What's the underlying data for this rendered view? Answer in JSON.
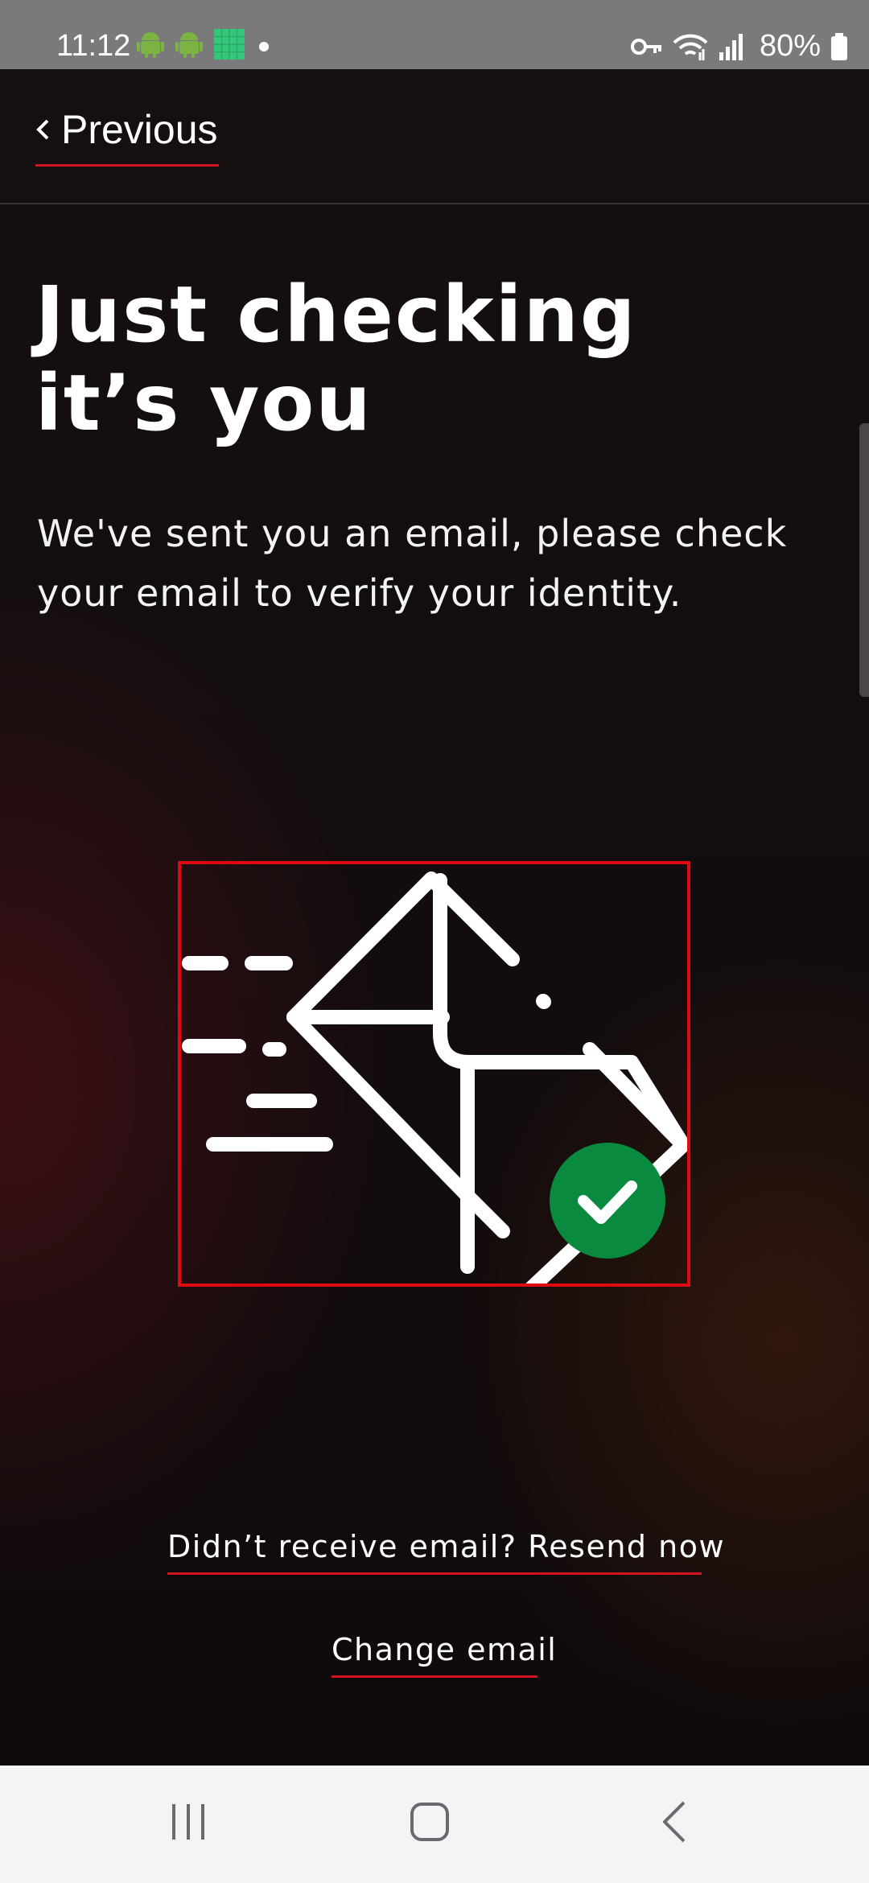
{
  "status_bar": {
    "time": "11:12",
    "battery": "80%",
    "icons": [
      "android-icon",
      "android-icon",
      "grid-app-icon",
      "dot-icon",
      "key-icon",
      "wifi-icon",
      "signal-icon",
      "battery-icon"
    ]
  },
  "nav": {
    "previous_label": "Previous",
    "previous_icon": "chevron-left-icon"
  },
  "heading": {
    "line1": "Just checking",
    "line2": "it’s you"
  },
  "description": "We've sent you an email, please check your email to verify your identity.",
  "illustration": {
    "icon": "email-sent-verified-icon",
    "check_color": "#0a8a3f",
    "border_color": "#e00a12"
  },
  "links": {
    "resend": "Didn’t receive email? Resend now",
    "change_email": "Change email"
  },
  "system_nav": {
    "recents": "recents-icon",
    "home": "home-icon",
    "back": "back-icon"
  },
  "colors": {
    "accent": "#d0131f",
    "background": "#0f0a0b"
  }
}
